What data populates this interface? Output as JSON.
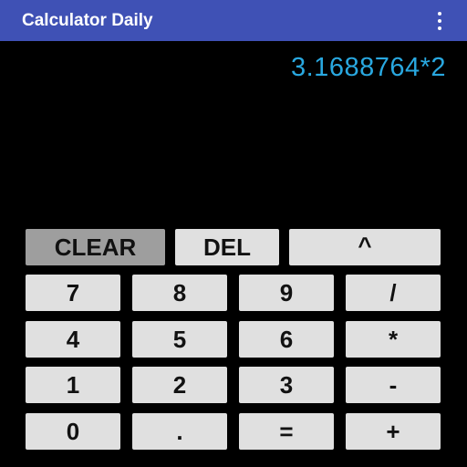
{
  "app_bar": {
    "title": "Calculator Daily",
    "menu_icon": "overflow-menu-icon",
    "color": "#3f51b5"
  },
  "display": {
    "expression": "3.1688764*2",
    "color": "#29a8e0"
  },
  "keypad": {
    "top_row": {
      "clear": "CLEAR",
      "delete": "DEL",
      "power": "^"
    },
    "rows": [
      [
        "7",
        "8",
        "9",
        "/"
      ],
      [
        "4",
        "5",
        "6",
        "*"
      ],
      [
        "1",
        "2",
        "3",
        "-"
      ],
      [
        "0",
        ".",
        "=",
        "+"
      ]
    ],
    "key_color": "#e0e0e0",
    "pressed_key_color": "#9e9e9e",
    "pressed_key": "CLEAR"
  }
}
